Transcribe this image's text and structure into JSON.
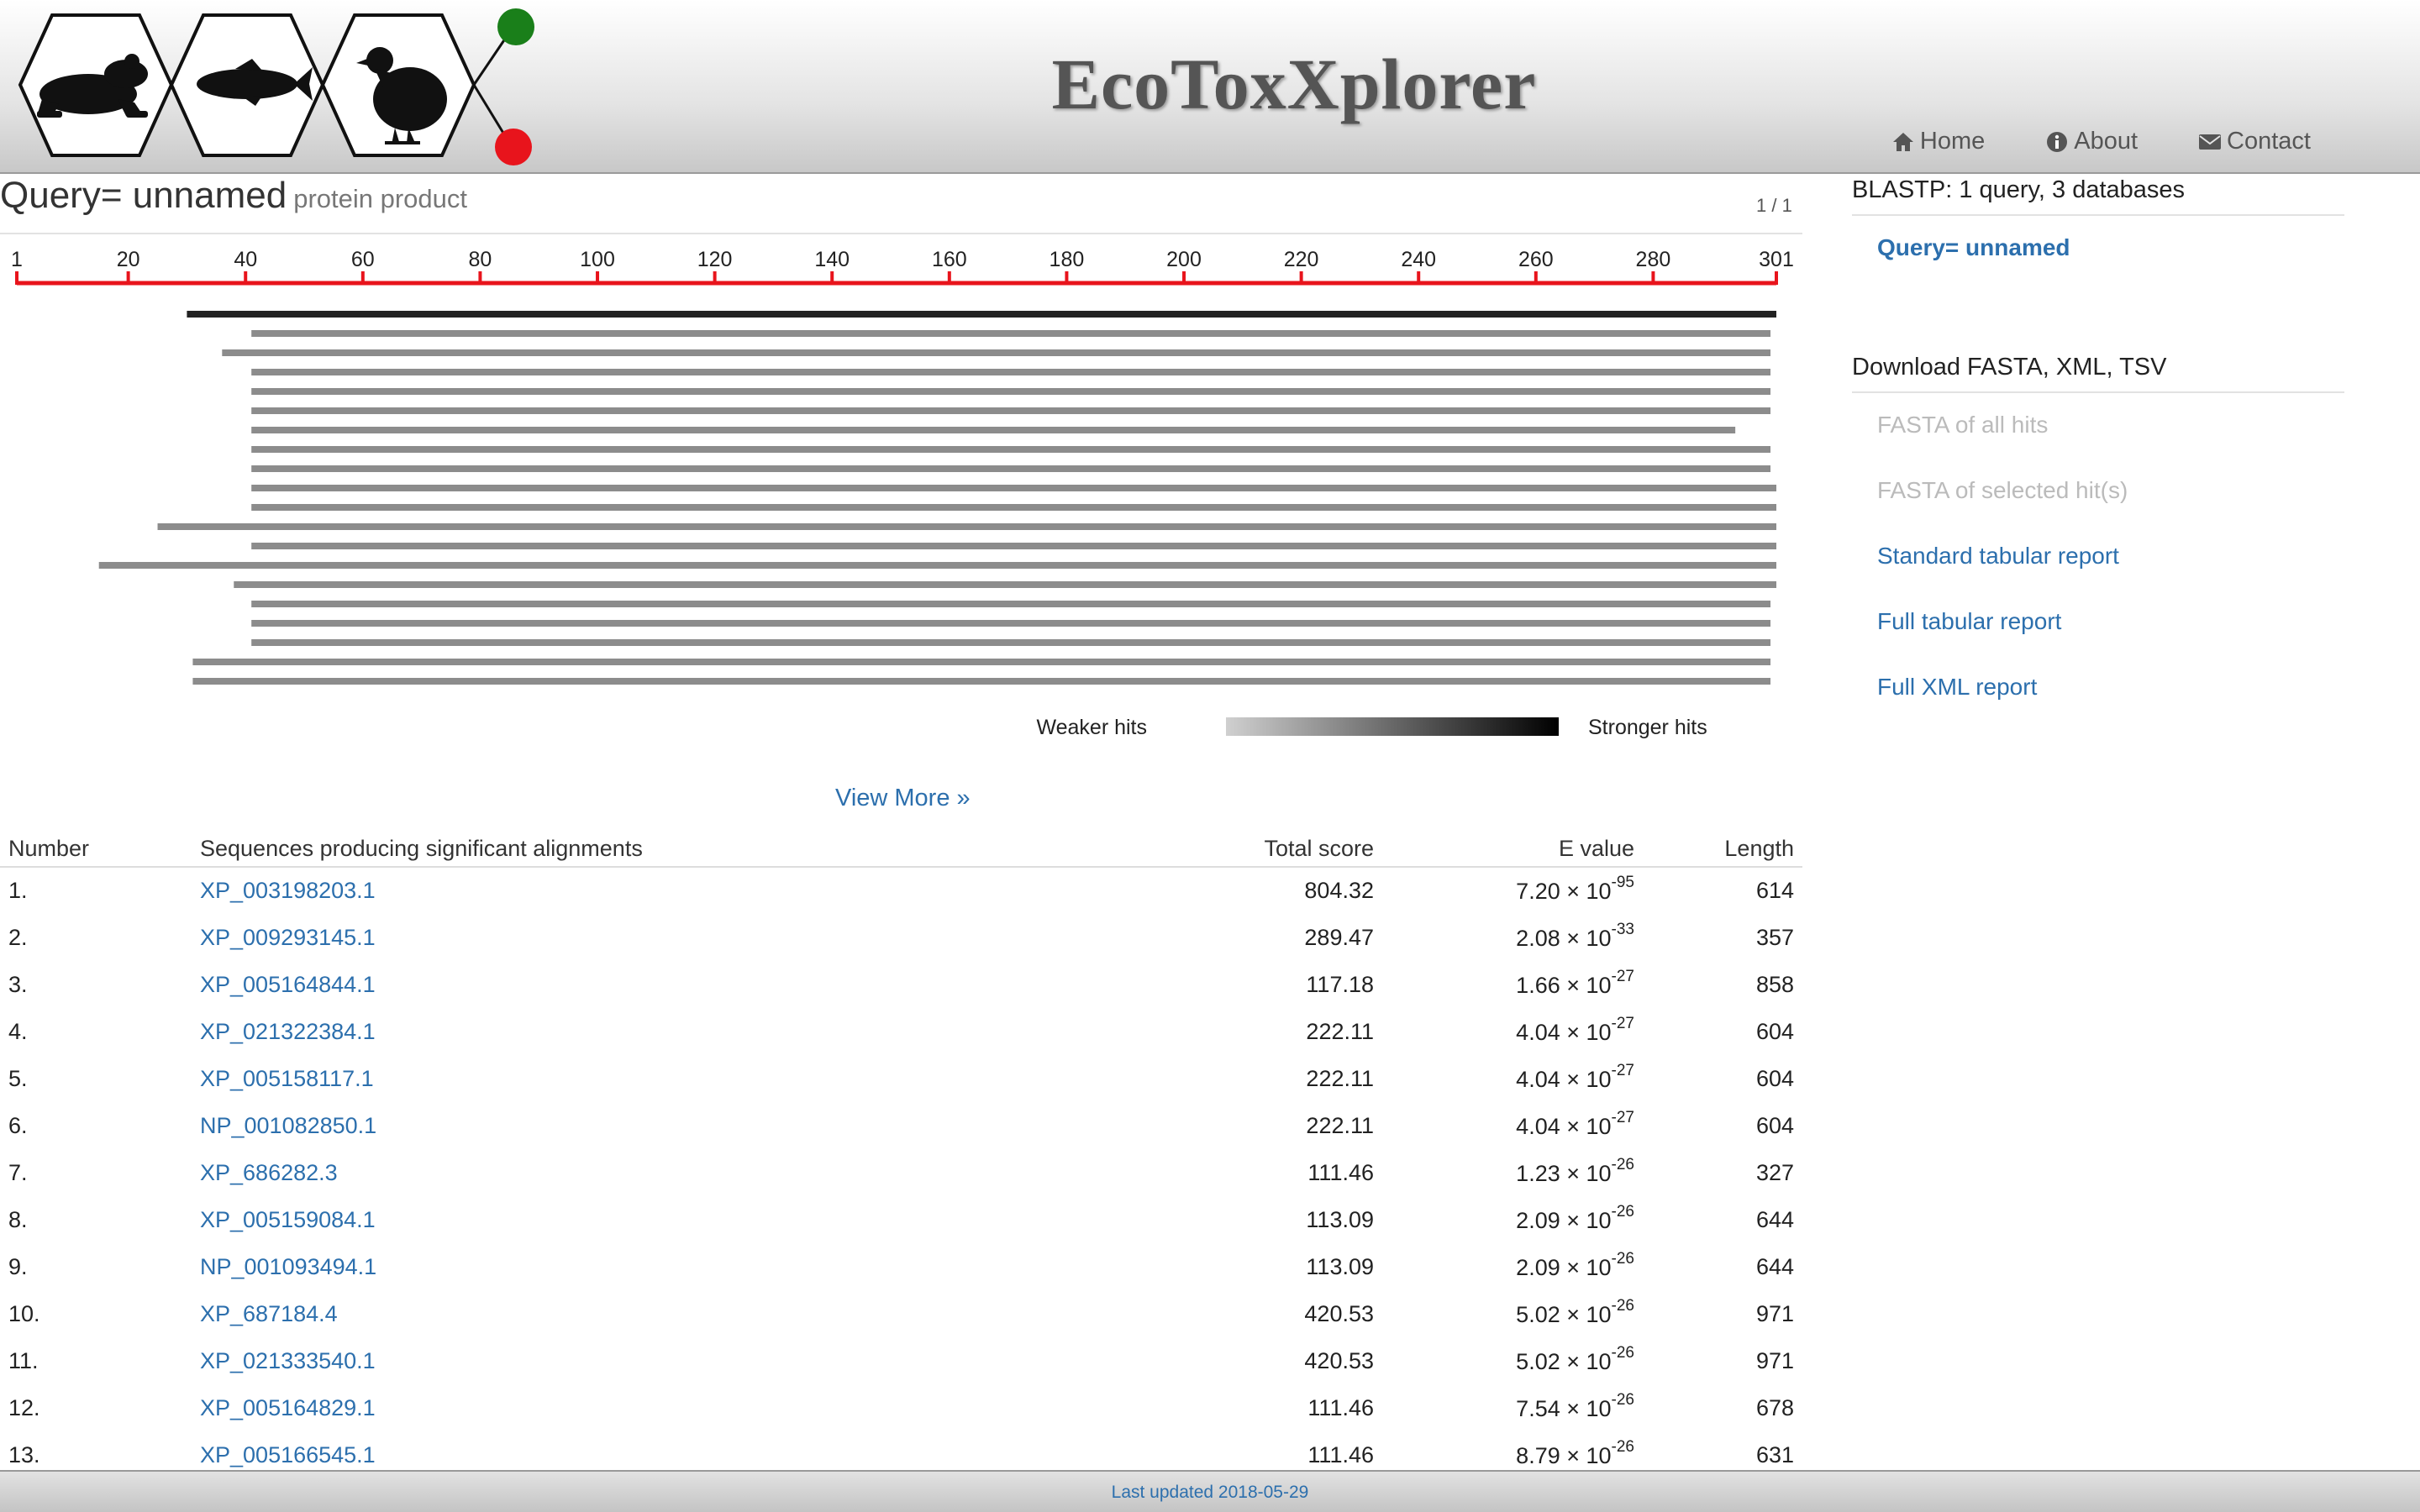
{
  "header": {
    "title": "EcoToxXplorer",
    "logo_icons": [
      "frog-icon",
      "fish-icon",
      "bird-icon"
    ],
    "status_dots": [
      "#1a7f1a",
      "#e8141c"
    ],
    "nav": [
      {
        "label": "Home",
        "icon": "home-icon"
      },
      {
        "label": "About",
        "icon": "info-icon"
      },
      {
        "label": "Contact",
        "icon": "envelope-icon"
      }
    ]
  },
  "query": {
    "title": "Query= unnamed",
    "subtitle": "protein product",
    "page_count": "1 / 1"
  },
  "chart_data": {
    "type": "alignment-overview",
    "query_length": 301,
    "ticks": [
      1,
      20,
      40,
      60,
      80,
      100,
      120,
      140,
      160,
      180,
      200,
      220,
      240,
      260,
      280,
      301
    ],
    "hits": [
      {
        "start": 30,
        "end": 301,
        "strength": 1.0
      },
      {
        "start": 41,
        "end": 300,
        "strength": 0.45
      },
      {
        "start": 36,
        "end": 300,
        "strength": 0.45
      },
      {
        "start": 41,
        "end": 300,
        "strength": 0.45
      },
      {
        "start": 41,
        "end": 300,
        "strength": 0.45
      },
      {
        "start": 41,
        "end": 300,
        "strength": 0.45
      },
      {
        "start": 41,
        "end": 294,
        "strength": 0.45
      },
      {
        "start": 41,
        "end": 300,
        "strength": 0.45
      },
      {
        "start": 41,
        "end": 300,
        "strength": 0.45
      },
      {
        "start": 41,
        "end": 301,
        "strength": 0.45
      },
      {
        "start": 41,
        "end": 301,
        "strength": 0.45
      },
      {
        "start": 25,
        "end": 301,
        "strength": 0.45
      },
      {
        "start": 41,
        "end": 301,
        "strength": 0.45
      },
      {
        "start": 15,
        "end": 301,
        "strength": 0.45
      },
      {
        "start": 38,
        "end": 301,
        "strength": 0.45
      },
      {
        "start": 41,
        "end": 300,
        "strength": 0.45
      },
      {
        "start": 41,
        "end": 300,
        "strength": 0.45
      },
      {
        "start": 41,
        "end": 300,
        "strength": 0.45
      },
      {
        "start": 31,
        "end": 300,
        "strength": 0.45
      },
      {
        "start": 31,
        "end": 300,
        "strength": 0.45
      }
    ],
    "legend": {
      "weaker": "Weaker hits",
      "stronger": "Stronger hits"
    }
  },
  "view_more": "View More »",
  "table": {
    "headers": {
      "number": "Number",
      "sequence": "Sequences producing significant alignments",
      "score": "Total score",
      "evalue": "E value",
      "length": "Length"
    },
    "rows": [
      {
        "num": "1.",
        "id": "XP_003198203.1",
        "score": "804.32",
        "e_mant": "7.20 × 10",
        "e_exp": "-95",
        "len": "614"
      },
      {
        "num": "2.",
        "id": "XP_009293145.1",
        "score": "289.47",
        "e_mant": "2.08 × 10",
        "e_exp": "-33",
        "len": "357"
      },
      {
        "num": "3.",
        "id": "XP_005164844.1",
        "score": "117.18",
        "e_mant": "1.66 × 10",
        "e_exp": "-27",
        "len": "858"
      },
      {
        "num": "4.",
        "id": "XP_021322384.1",
        "score": "222.11",
        "e_mant": "4.04 × 10",
        "e_exp": "-27",
        "len": "604"
      },
      {
        "num": "5.",
        "id": "XP_005158117.1",
        "score": "222.11",
        "e_mant": "4.04 × 10",
        "e_exp": "-27",
        "len": "604"
      },
      {
        "num": "6.",
        "id": "NP_001082850.1",
        "score": "222.11",
        "e_mant": "4.04 × 10",
        "e_exp": "-27",
        "len": "604"
      },
      {
        "num": "7.",
        "id": "XP_686282.3",
        "score": "111.46",
        "e_mant": "1.23 × 10",
        "e_exp": "-26",
        "len": "327"
      },
      {
        "num": "8.",
        "id": "XP_005159084.1",
        "score": "113.09",
        "e_mant": "2.09 × 10",
        "e_exp": "-26",
        "len": "644"
      },
      {
        "num": "9.",
        "id": "NP_001093494.1",
        "score": "113.09",
        "e_mant": "2.09 × 10",
        "e_exp": "-26",
        "len": "644"
      },
      {
        "num": "10.",
        "id": "XP_687184.4",
        "score": "420.53",
        "e_mant": "5.02 × 10",
        "e_exp": "-26",
        "len": "971"
      },
      {
        "num": "11.",
        "id": "XP_021333540.1",
        "score": "420.53",
        "e_mant": "5.02 × 10",
        "e_exp": "-26",
        "len": "971"
      },
      {
        "num": "12.",
        "id": "XP_005164829.1",
        "score": "111.46",
        "e_mant": "7.54 × 10",
        "e_exp": "-26",
        "len": "678"
      },
      {
        "num": "13.",
        "id": "XP_005166545.1",
        "score": "111.46",
        "e_mant": "8.79 × 10",
        "e_exp": "-26",
        "len": "631"
      }
    ]
  },
  "sidebar": {
    "search_heading": "BLASTP: 1 query, 3 databases",
    "query_link": "Query= unnamed",
    "download_heading": "Download FASTA, XML, TSV",
    "downloads": [
      {
        "label": "FASTA of all hits",
        "enabled": false
      },
      {
        "label": "FASTA of selected hit(s)",
        "enabled": false
      },
      {
        "label": "Standard tabular report",
        "enabled": true
      },
      {
        "label": "Full tabular report",
        "enabled": true
      },
      {
        "label": "Full XML report",
        "enabled": true
      }
    ]
  },
  "footer": {
    "text": "Last updated 2018-05-29"
  },
  "colors": {
    "link": "#2c6fad",
    "ruler": "#e8141c",
    "disabled": "#bbbbbb"
  }
}
